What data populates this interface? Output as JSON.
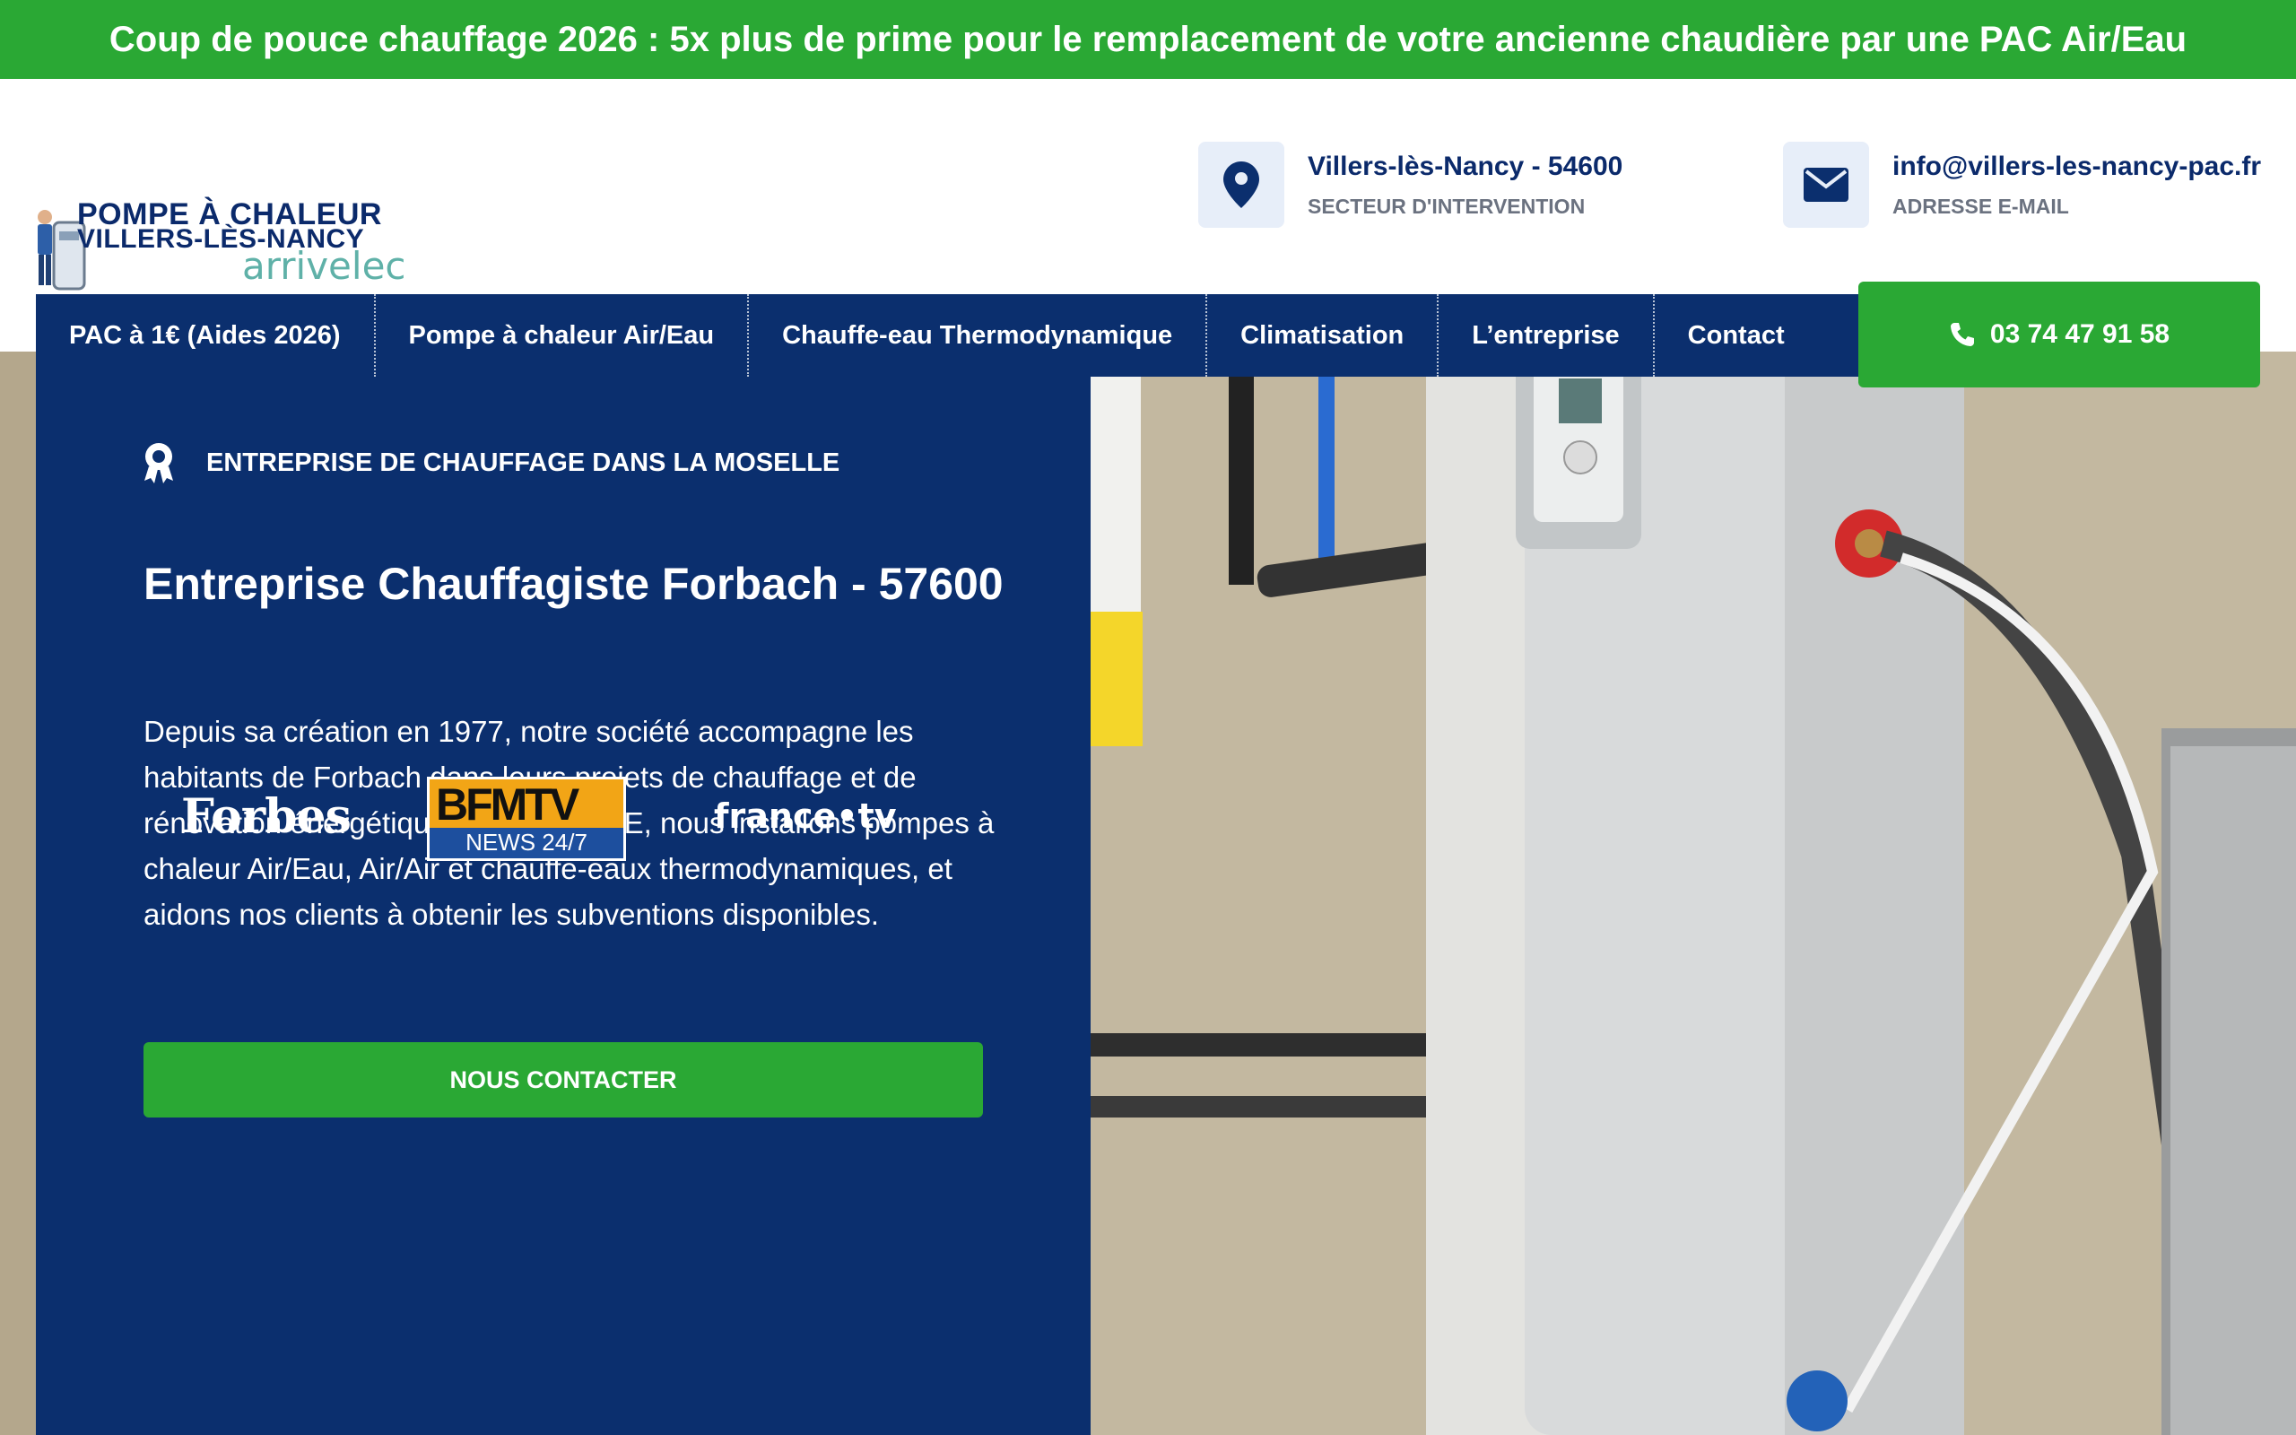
{
  "promo": {
    "text": "Coup de pouce chauffage 2026 : 5x plus de prime pour le remplacement de votre ancienne chaudière par une PAC Air/Eau"
  },
  "logo": {
    "line1": "POMPE À CHALEUR",
    "line2": "VILLERS-LÈS-NANCY",
    "line3": "arrivelec"
  },
  "contacts": {
    "location": {
      "title": "Villers-lès-Nancy - 54600",
      "subtitle": "SECTEUR D'INTERVENTION",
      "icon": "map-pin-icon"
    },
    "email": {
      "title": "info@villers-les-nancy-pac.fr",
      "subtitle": "ADRESSE E-MAIL",
      "icon": "envelope-icon"
    }
  },
  "nav": {
    "items": [
      {
        "label": "PAC à 1€ (Aides 2026)"
      },
      {
        "label": "Pompe à chaleur Air/Eau"
      },
      {
        "label": "Chauffe-eau Thermodynamique"
      },
      {
        "label": "Climatisation"
      },
      {
        "label": "L’entreprise"
      },
      {
        "label": "Contact"
      }
    ],
    "phone": "03 74 47 91 58"
  },
  "hero": {
    "badge": "ENTREPRISE DE CHAUFFAGE DANS LA MOSELLE",
    "title": "Entreprise Chauffagiste Forbach - 57600",
    "description": "Depuis sa création en 1977, notre société accompagne les habitants de Forbach dans leurs projets de chauffage et de rénovation énergétique. Certifiés RGE, nous installons pompes à chaleur Air/Eau, Air/Air et chauffe-eaux thermodynamiques, et aidons nos clients à obtenir les subventions disponibles.",
    "cta": "NOUS CONTACTER"
  },
  "media_logos": {
    "forbes": "Forbes",
    "bfm_top": "BFMTV",
    "bfm_bottom": "NEWS 24/7",
    "francetv": "france•tv"
  },
  "colors": {
    "green": "#2aa834",
    "navy": "#0b2f6e",
    "icon_bg": "#e7eef9"
  }
}
